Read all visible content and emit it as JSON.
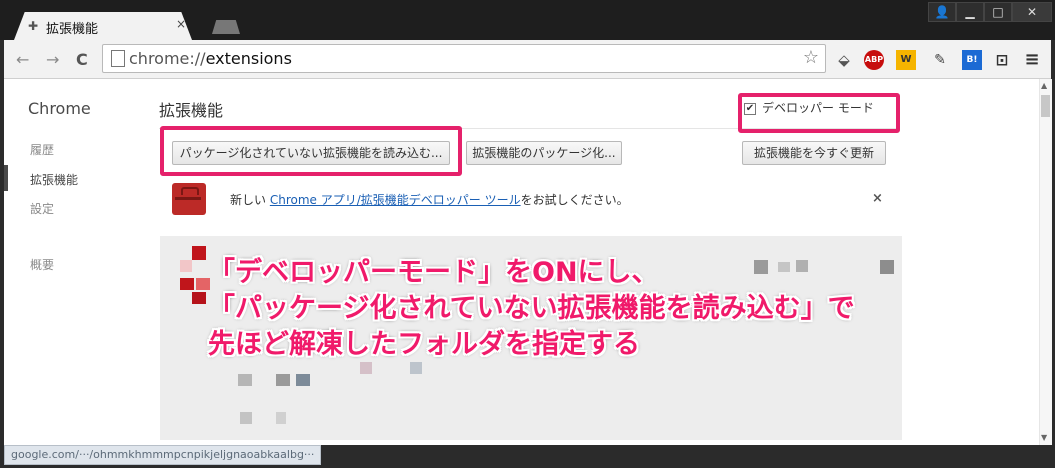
{
  "tab": {
    "title": "拡張機能",
    "close": "×"
  },
  "window_controls": {
    "user": "👤",
    "minimize": "▁",
    "maximize": "□",
    "close": "✕"
  },
  "toolbar": {
    "back": "←",
    "forward": "→",
    "reload": "C",
    "url_scheme": "chrome://",
    "url_host": "extensions",
    "bookmark_star": "☆"
  },
  "extensions": [
    {
      "name": "abp-icon",
      "label": "ABP"
    },
    {
      "name": "w-icon",
      "label": "W"
    },
    {
      "name": "pen-icon",
      "label": "✎"
    },
    {
      "name": "hatena-bookmark-icon",
      "label": "B!"
    },
    {
      "name": "plug-icon",
      "label": "⊡"
    },
    {
      "name": "menu-icon",
      "label": "≡"
    }
  ],
  "sidebar": {
    "title": "Chrome",
    "items": [
      {
        "label": "履歴"
      },
      {
        "label": "拡張機能"
      },
      {
        "label": "設定"
      },
      {
        "label": "概要"
      }
    ]
  },
  "main": {
    "heading": "拡張機能",
    "developer_mode": {
      "label": "デベロッパー モード",
      "checked": true,
      "check": "✔"
    },
    "buttons": {
      "load_unpacked": "パッケージ化されていない拡張機能を読み込む...",
      "pack": "拡張機能のパッケージ化...",
      "update": "拡張機能を今すぐ更新"
    },
    "promo": {
      "prefix": "新しい ",
      "link": "Chrome アプリ/拡張機能デベロッパー ツール",
      "suffix": "をお試しください。",
      "close": "×"
    }
  },
  "annotation": {
    "line1": "「デベロッパーモード」をONにし、",
    "line2": "「パッケージ化されていない拡張機能を読み込む」で",
    "line3": "先ほど解凍したフォルダを指定する",
    "color": "#f01a6a"
  },
  "status": {
    "url": "google.com/···/ohmmkhmmmpcnpikjeljgnaoabkaalbg···"
  }
}
